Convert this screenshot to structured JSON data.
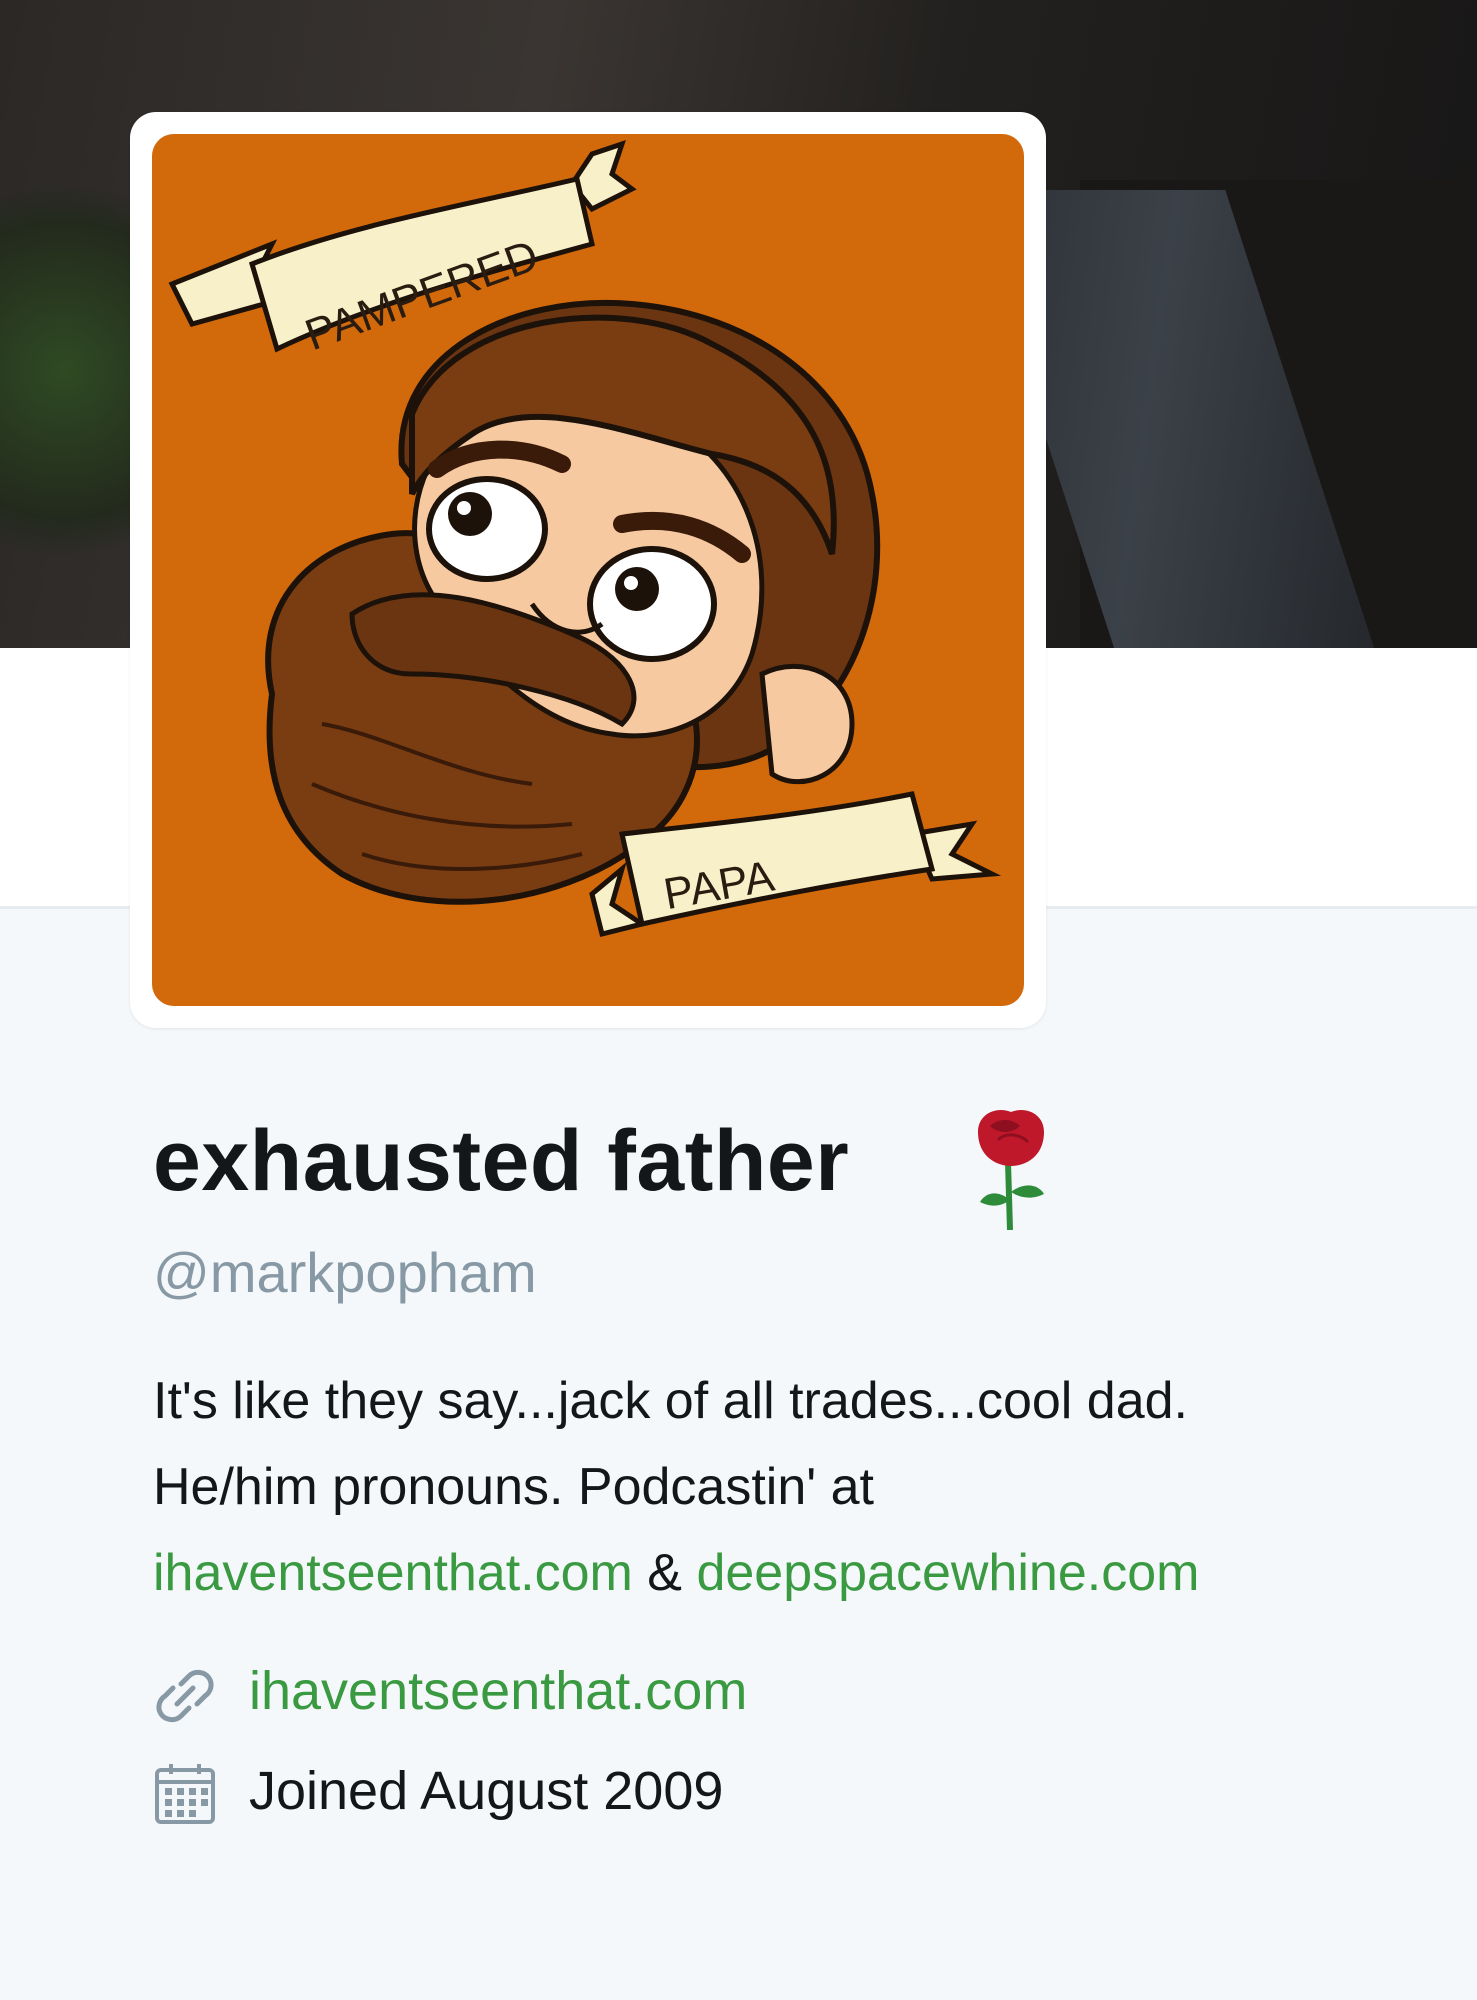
{
  "profile": {
    "display_name": "exhausted father",
    "name_emoji_icon": "rose-icon",
    "handle": "@markpopham",
    "bio": {
      "line1": "It's like they say...jack of all trades...cool dad.",
      "line2": "He/him pronouns. Podcastin' at",
      "link1": "ihaventseenthat.com",
      "amp": " & ",
      "link2": "deepspacewhine.com"
    },
    "website": "ihaventseenthat.com",
    "website_icon": "link-icon",
    "joined": "Joined August 2009",
    "joined_icon": "calendar-icon"
  },
  "avatar": {
    "banner_top_text": "PAMPERED",
    "banner_bottom_text": "PAPA"
  },
  "colors": {
    "link": "#3a9a42",
    "avatar_bg": "#d2690a",
    "muted": "#8899a6",
    "text": "#14171a"
  }
}
